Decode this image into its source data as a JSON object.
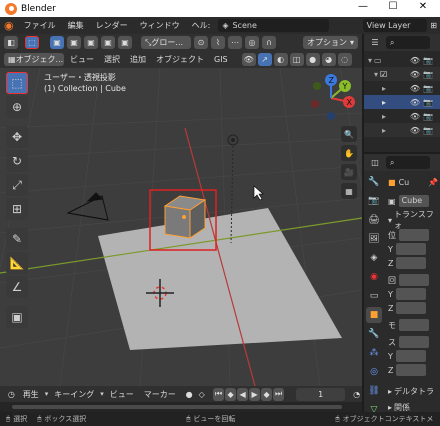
{
  "window": {
    "title": "Blender",
    "minimize": "—",
    "maximize": "☐",
    "close": "✕"
  },
  "menubar": {
    "items": [
      "ファイル",
      "編集",
      "レンダー",
      "ウィンドウ",
      "ヘル:"
    ],
    "scene": "Scene",
    "view_layer": "View Layer"
  },
  "viewport_header": {
    "transform_orientation": "グロー...",
    "options": "オプション",
    "mode": "オブジェク...",
    "menus": [
      "ビュー",
      "選択",
      "追加",
      "オブジェクト",
      "GIS"
    ]
  },
  "viewport": {
    "view_name": "ユーザー・透視投影",
    "collection_line": "(1) Collection | Cube",
    "gizmo": {
      "x": "X",
      "y": "Y",
      "z": "Z"
    }
  },
  "properties": {
    "object_name": "Cu",
    "data_name": "Cube",
    "transform_label": "トランスフォ",
    "rows": [
      "位",
      "Y",
      "Z",
      "回",
      "Y",
      "Z",
      "モ",
      "ス",
      "Y",
      "Z"
    ],
    "delta_transform": "デルタトラ",
    "relations": "関係"
  },
  "timeline": {
    "menus": [
      "再生",
      "キーイング",
      "ビュー",
      "マーカー"
    ],
    "frame": "1"
  },
  "statusbar": {
    "select": "選択",
    "box_select": "ボックス選択",
    "rotate_view": "ビューを回転",
    "object_context": "オブジェクトコンテキストメ"
  },
  "colors": {
    "accent": "#4772b3",
    "highlight": "#e02020",
    "selected_outline": "#ffa033"
  }
}
